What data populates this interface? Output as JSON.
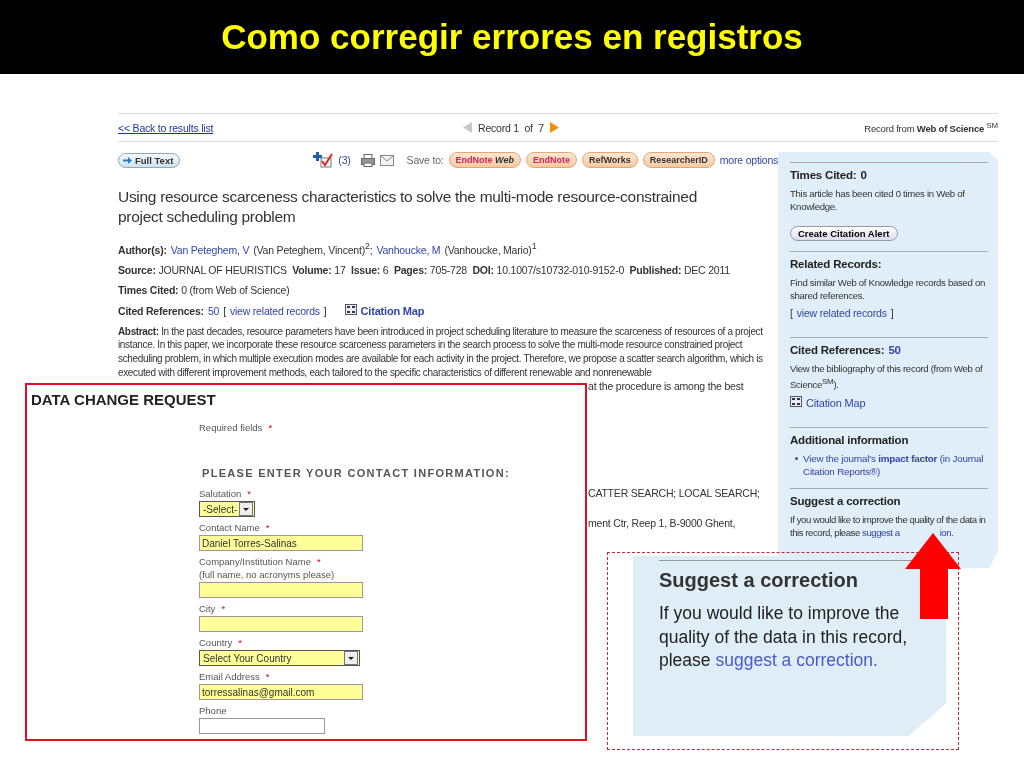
{
  "slide_title": "Como corregir errores en registros",
  "page": {
    "back_link": "<< Back to results list",
    "record_position": "Record 1  of  7",
    "record_source": "Record from **Web of Science** $^{SM}$",
    "toolbar": {
      "full_text": "Full Text",
      "marked_count": "(3)",
      "save_to": "Save to:",
      "more_options": "more options",
      "save_buttons": [
        {
          "kind": "endnote",
          "label": "EndNote",
          "suffix": "Web"
        },
        {
          "kind": "endnote",
          "label": "EndNote"
        },
        {
          "kind": "plain",
          "label": "RefWorks"
        },
        {
          "kind": "plain",
          "label": "ResearcherID"
        }
      ]
    },
    "article_title": "Using resource scarceness characteristics to solve the multi-mode resource-constrained project scheduling problem",
    "authors": {
      "label": "Author(s):",
      "items": [
        {
          "link": "Van Peteghem, V",
          "full": "(Van Peteghem, Vincent)$^{2}$;"
        },
        {
          "link": "Vanhoucke, M",
          "full": "(Vanhoucke, Mario)$^{1}$"
        }
      ]
    },
    "source": "**Source:** JOURNAL OF HEURISTICS  **Volume:** 17  **Issue:** 6  **Pages:** 705-728  **DOI:** 10.1007/s10732-010-9152-0  **Published:** DEC 2011",
    "times_cited": "**Times Cited:** 0 (from Web of Science)",
    "cited_references": {
      "label": "Cited References:",
      "count": "50",
      "open": "[",
      "link": "view related records",
      "close": "]",
      "citation_map": "Citation Map"
    },
    "abstract": "**Abstract:** In the past decades, resource parameters have been introduced in project scheduling literature to measure the scarceness of resources of a project instance. In this paper, we incorporate these resource scarceness parameters in the search process to solve the multi-mode resource constrained project scheduling problem, in which multiple execution modes are available for each activity in the project. Therefore, we propose a scatter search algorithm, which is executed with different improvement methods, each tailored to the specific characteristics of different renewable and nonrenewable",
    "abstract_fragment": "at the procedure is among the best",
    "keywords_fragment": "CATTER SEARCH; LOCAL SEARCH;",
    "address_fragment": "ment Ctr, Reep 1, B-9000 Ghent,"
  },
  "sidebar": [
    {
      "kind": "cited",
      "heading": "Times Cited:",
      "count": "0",
      "text": "This article has been cited 0 times in Web of Knowledge.",
      "button": "Create Citation Alert"
    },
    {
      "kind": "related",
      "heading": "Related Records:",
      "text": "Find similar Web of Knowledge records based on shared references.",
      "open": "[",
      "link": "view related records",
      "close": "]"
    },
    {
      "kind": "references",
      "heading": "Cited References:",
      "count": "50",
      "text": "View the bibliography of this record (from Web of Science$^{SM}$).",
      "map_link": "Citation Map"
    },
    {
      "kind": "additional",
      "heading": "Additional information",
      "bullet_link": "View the journal's **impact factor** (in Journal Citation Reports®)"
    },
    {
      "kind": "suggest",
      "heading": "Suggest a correction",
      "text": "If you would like to improve the quality of the data in this record, please",
      "link": "suggest a",
      "link_tail": "ion."
    }
  ],
  "data_change_request": {
    "title": "DATA CHANGE REQUEST",
    "required_note": "Required fields",
    "required_mark": "*",
    "section_heading": "PLEASE ENTER YOUR CONTACT INFORMATION:",
    "fields": [
      {
        "kind": "short_select",
        "label": "Salutation",
        "mark": "*",
        "value": "-Select-",
        "highlighted": true
      },
      {
        "kind": "text",
        "label": "Contact Name",
        "mark": "*",
        "value": "Daniel Torres-Salinas",
        "highlighted": true
      },
      {
        "kind": "text",
        "label": "Company/Institution Name",
        "mark": "*",
        "hint": "(full name, no acronyms please)",
        "highlighted": true
      },
      {
        "kind": "text",
        "label": "City",
        "mark": "*",
        "highlighted": true
      },
      {
        "kind": "select",
        "label": "Country",
        "mark": "*",
        "value": "Select Your Country",
        "highlighted": true
      },
      {
        "kind": "text",
        "label": "Email Address",
        "mark": "*",
        "value": "torressalinas@gmail.com",
        "highlighted": true
      },
      {
        "kind": "short_text",
        "label": "Phone",
        "highlighted": false
      }
    ]
  },
  "callout": {
    "heading": "Suggest a correction",
    "text": "If you would like to improve the quality of the data in this record, please",
    "link": "suggest a correction."
  }
}
